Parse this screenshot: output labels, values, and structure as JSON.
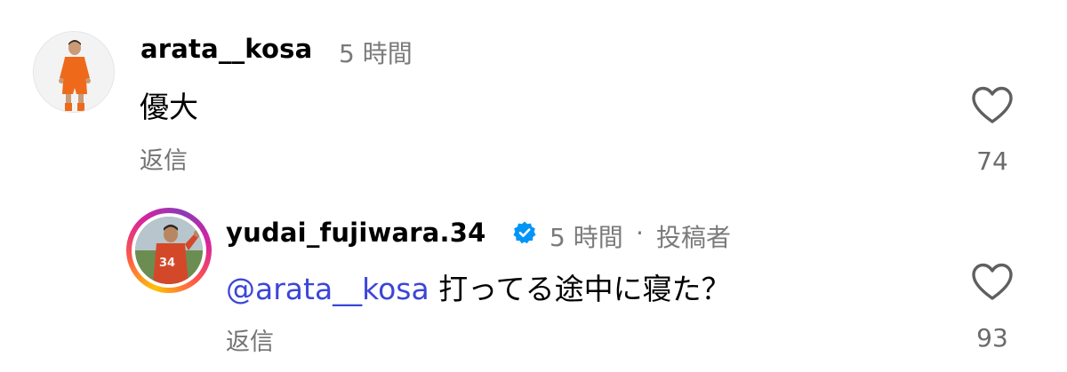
{
  "comments": [
    {
      "username": "arata__kosa",
      "time": "5 時間",
      "text": "優大",
      "reply_label": "返信",
      "like_count": "74"
    },
    {
      "username": "yudai_fujiwara.34",
      "time": "5 時間",
      "separator": "·",
      "author_badge": "投稿者",
      "mention": "@arata__kosa",
      "text": "打ってる途中に寝た？",
      "reply_label": "返信",
      "like_count": "93",
      "verified": true
    }
  ],
  "icons": {
    "like": "heart-outline-icon",
    "verified": "verified-badge-icon"
  },
  "colors": {
    "mention": "#3b46d8",
    "verified": "#0095f6",
    "muted_text": "#737373",
    "story_ring": [
      "#ffc107",
      "#fd5949",
      "#d6249f",
      "#8a3ab9"
    ]
  }
}
